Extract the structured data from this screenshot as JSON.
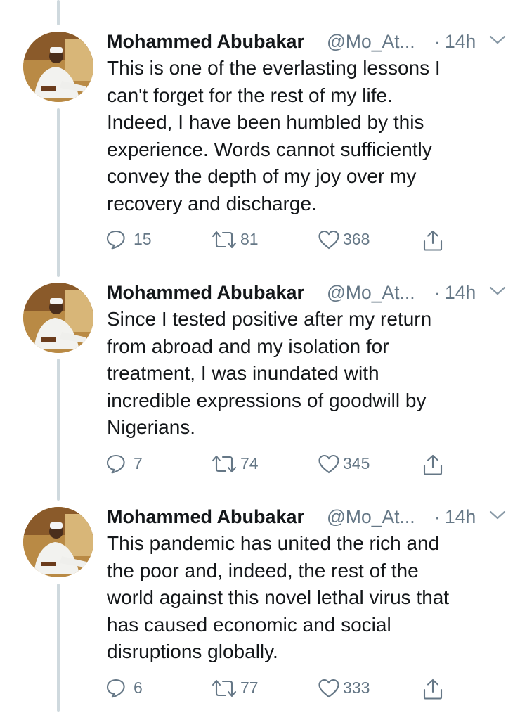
{
  "thread": {
    "author_name": "Mohammed Abubakar",
    "author_handle": "@Mo_At...",
    "separator": "·",
    "tweets": [
      {
        "time": "14h",
        "text": "This is one of the everlasting lessons I\ncan't forget for the rest of my life.\nIndeed, I have been humbled by this\nexperience. Words cannot sufficiently\nconvey the depth of my joy over my\nrecovery and discharge.",
        "replies": "15",
        "retweets": "81",
        "likes": "368"
      },
      {
        "time": "14h",
        "text": "Since I tested positive after my return\nfrom abroad and my isolation for\ntreatment, I was inundated with\nincredible expressions of goodwill by\nNigerians.",
        "replies": "7",
        "retweets": "74",
        "likes": "345"
      },
      {
        "time": "14h",
        "text": "This pandemic has united the rich and\nthe poor and, indeed, the rest of the\nworld against this novel lethal virus that\nhas caused economic and social\ndisruptions globally.",
        "replies": "6",
        "retweets": "77",
        "likes": "333"
      }
    ]
  },
  "icons": {
    "reply": "reply-icon",
    "retweet": "retweet-icon",
    "like": "heart-icon",
    "share": "share-icon",
    "more": "chevron-down-icon"
  },
  "colors": {
    "text": "#14171a",
    "secondary": "#657786",
    "thread_line": "#cfd9de",
    "background": "#ffffff"
  }
}
